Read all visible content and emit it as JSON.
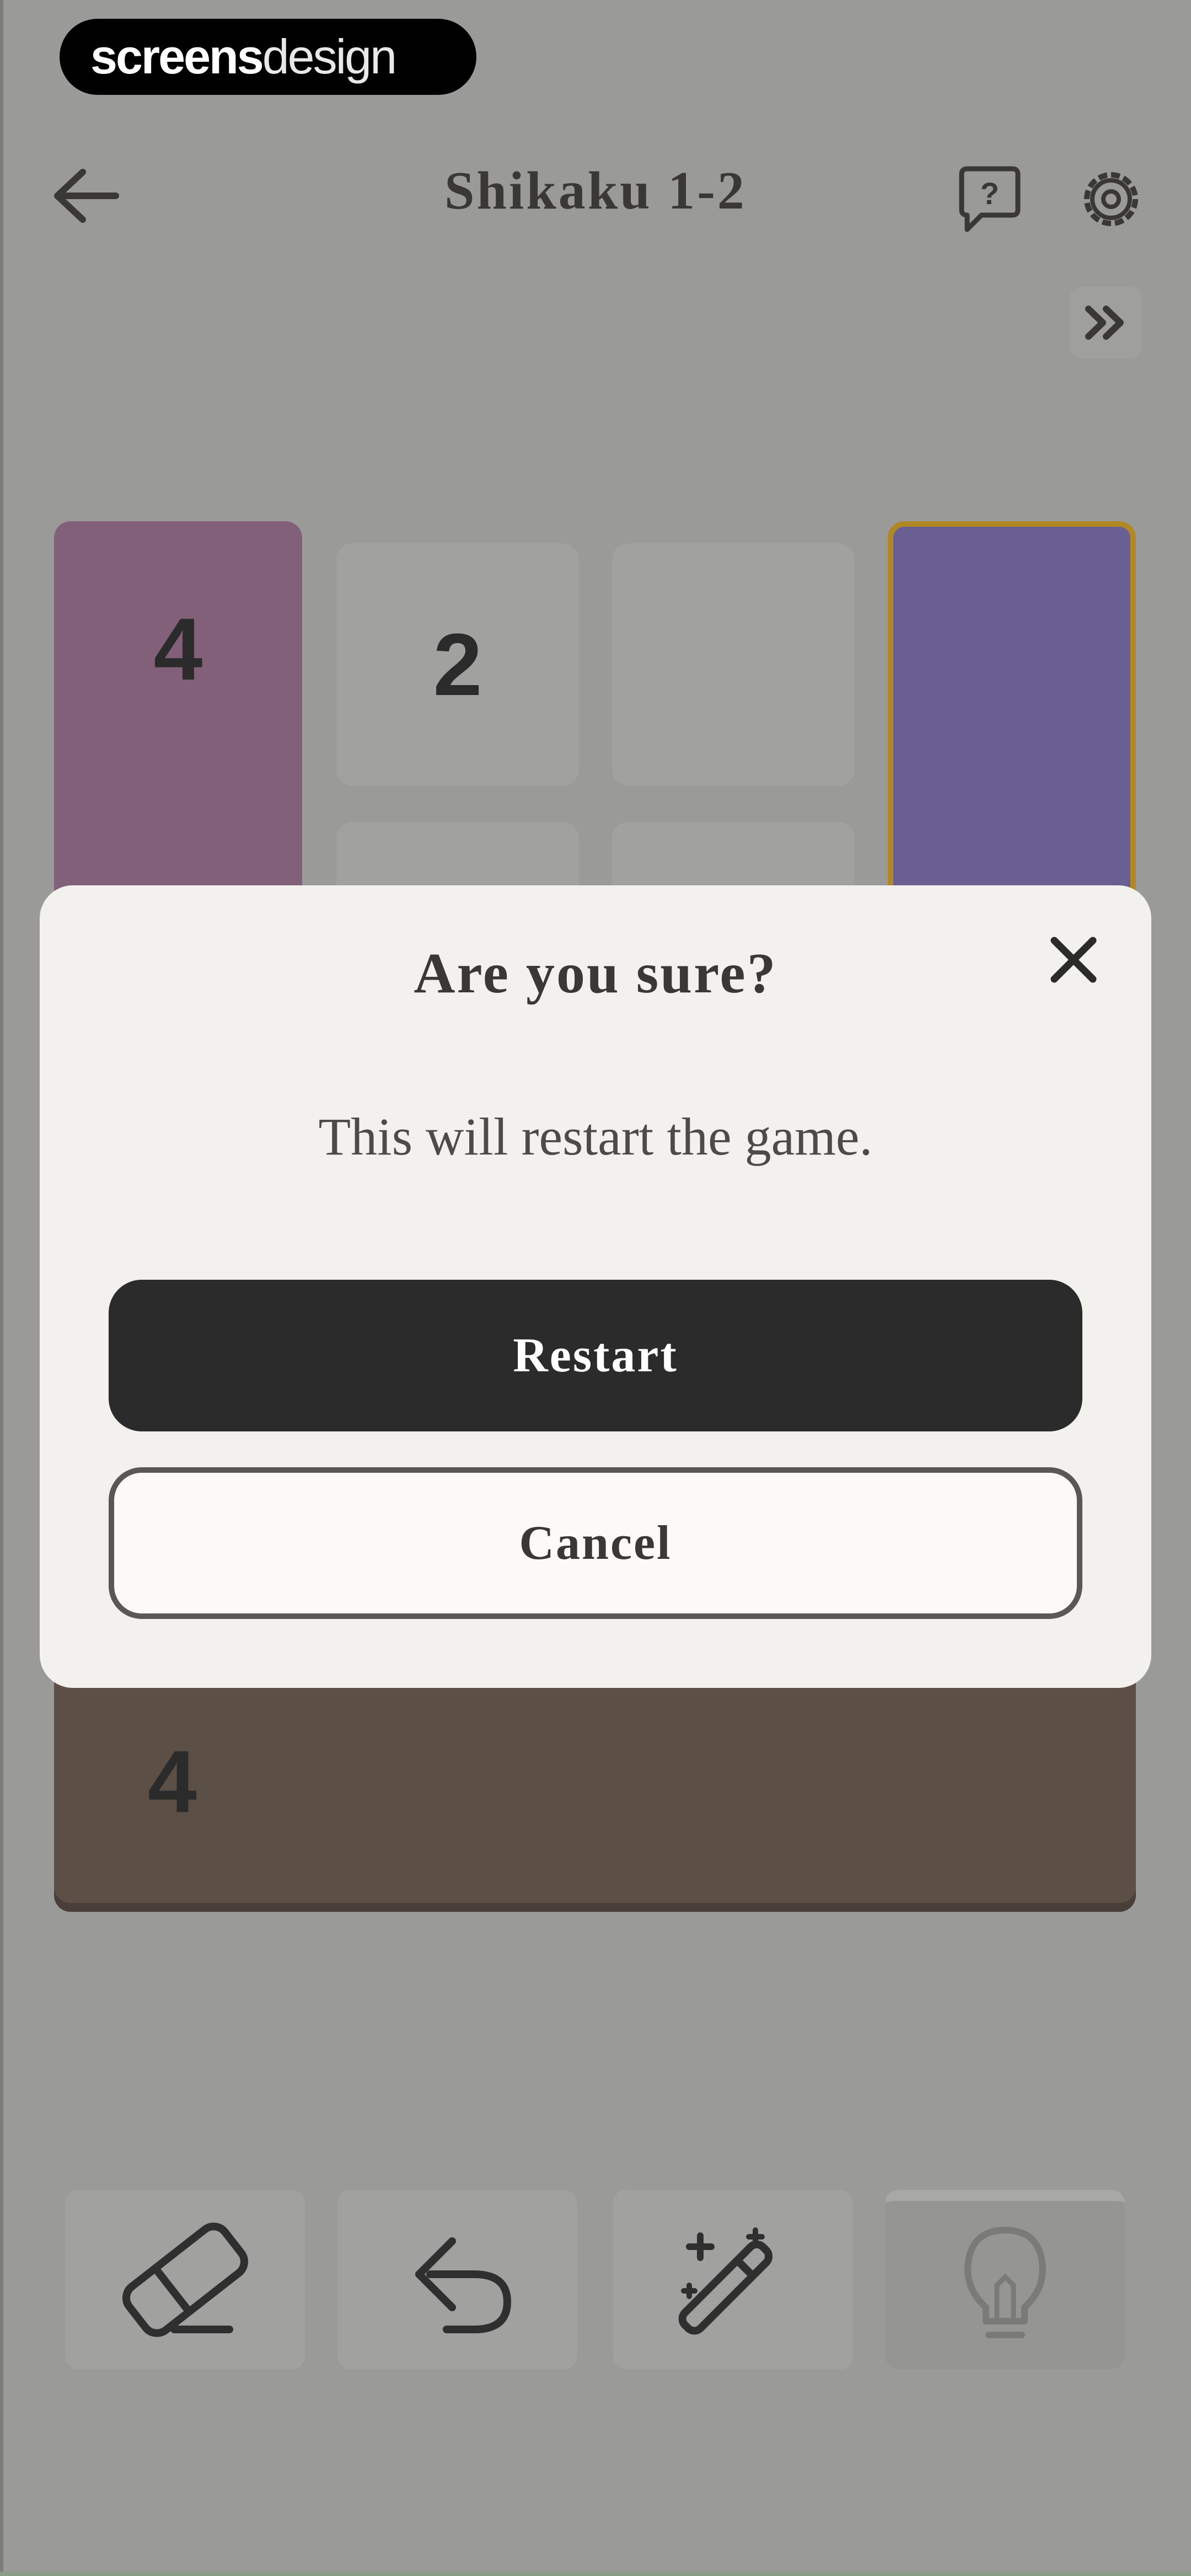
{
  "brand": {
    "bold": "screens",
    "light": "design"
  },
  "header": {
    "title": "Shikaku 1-2",
    "back_icon": "arrow-left-icon",
    "help_icon": "question-bubble-icon",
    "settings_icon": "gear-icon",
    "skip_icon": "double-chevron-right-icon"
  },
  "board": {
    "cells": [
      {
        "id": "purple",
        "value": "4",
        "color": "#82607a"
      },
      {
        "id": "clue-2",
        "value": "2",
        "color": "#a1a1a0"
      },
      {
        "id": "violet",
        "value": "",
        "color": "#6a5f92",
        "selected_border": "#b08826"
      },
      {
        "id": "brown",
        "value": "4",
        "color": "#5c4f46"
      }
    ]
  },
  "toolbar": {
    "tools": [
      {
        "name": "eraser",
        "icon": "eraser-icon"
      },
      {
        "name": "undo",
        "icon": "undo-icon"
      },
      {
        "name": "auto",
        "icon": "magic-wand-icon"
      },
      {
        "name": "hint",
        "icon": "lightbulb-icon",
        "disabled": true
      }
    ]
  },
  "modal": {
    "title": "Are you sure?",
    "message": "This will restart the game.",
    "restart_label": "Restart",
    "cancel_label": "Cancel",
    "close_icon": "close-icon"
  }
}
